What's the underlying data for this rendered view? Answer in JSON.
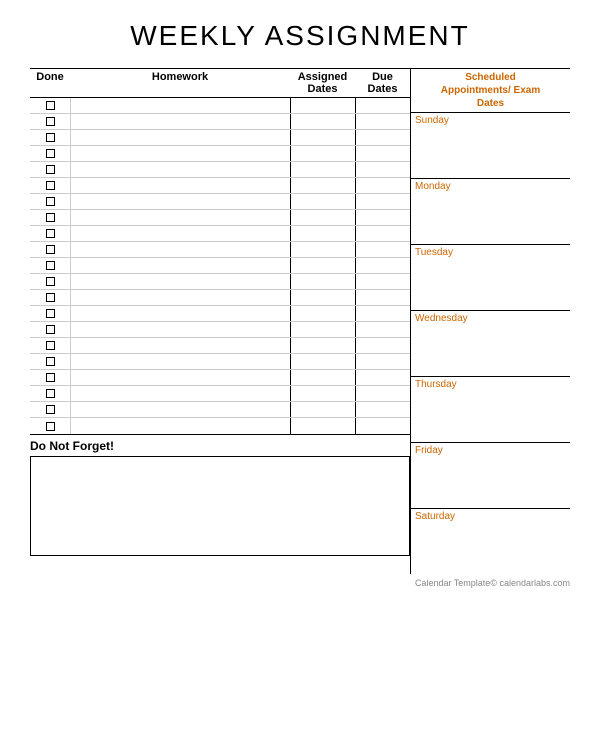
{
  "page": {
    "title": "WEEKLY ASSIGNMENT",
    "footer": "Calendar Template© calendarlabs.com"
  },
  "columns": {
    "done": "Done",
    "homework": "Homework",
    "assigned_dates": "Assigned\nDates",
    "due_dates": "Due\nDates",
    "scheduled": "Scheduled\nAppointments/ Exam\nDates"
  },
  "rows_count": 21,
  "do_not_forget_label": "Do Not Forget!",
  "days": [
    "Sunday",
    "Monday",
    "Tuesday",
    "Wednesday",
    "Thursday",
    "Friday",
    "Saturday"
  ]
}
